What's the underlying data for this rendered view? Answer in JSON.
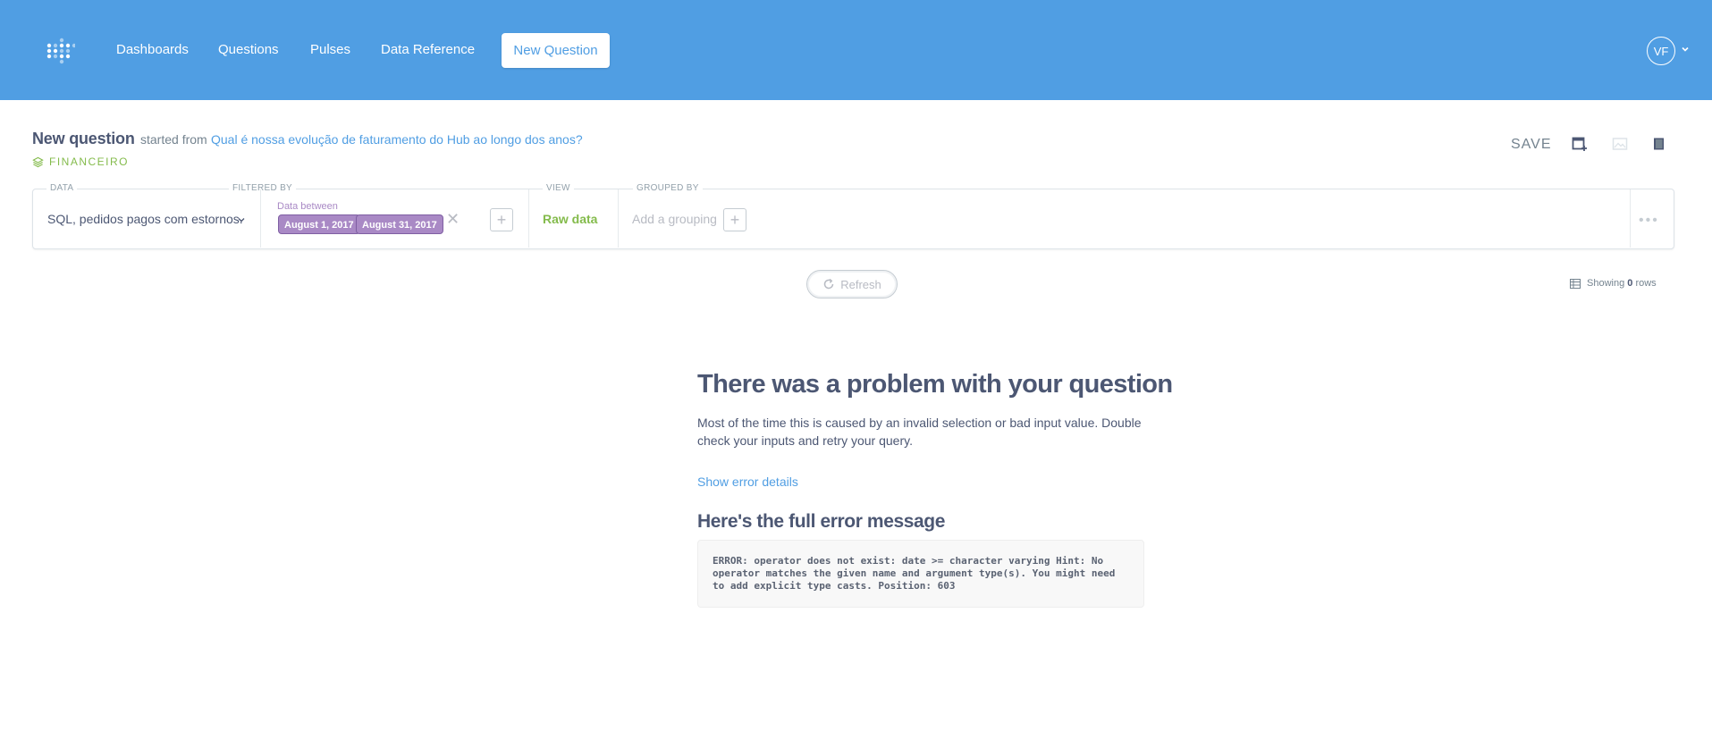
{
  "nav": {
    "logo_icon": "metabase-logo-icon",
    "links": [
      {
        "label": "Dashboards"
      },
      {
        "label": "Questions"
      },
      {
        "label": "Pulses"
      },
      {
        "label": "Data Reference"
      }
    ],
    "new_question": "New Question",
    "avatar_initials": "VF",
    "colors": {
      "bar": "#509ee3",
      "text": "#ffffff"
    }
  },
  "header": {
    "title": "New question",
    "started_from_prefix": "started from",
    "started_from_link": "Qual é nossa evolução de faturamento do Hub ao longo dos anos?",
    "collection": "FINANCEIRO",
    "save_label": "SAVE",
    "icons": [
      "add-to-dashboard-icon",
      "image-icon",
      "book-icon"
    ]
  },
  "query": {
    "data_label": "DATA",
    "data_source": "SQL, pedidos pagos com estornos.",
    "filtered_label": "FILTERED BY",
    "filter_label": "Data between",
    "filter_values": [
      "August 1, 2017",
      "August 31, 2017"
    ],
    "view_label": "VIEW",
    "view_value": "Raw data",
    "grouped_label": "GROUPED BY",
    "grouping_placeholder": "Add a grouping"
  },
  "results": {
    "refresh_label": "Refresh",
    "showing_prefix": "Showing",
    "row_count": "0",
    "showing_suffix": "rows"
  },
  "error": {
    "title": "There was a problem with your question",
    "description": "Most of the time this is caused by an invalid selection or bad input value. Double check your inputs and retry your query.",
    "details_link": "Show error details",
    "full_message_heading": "Here's the full error message",
    "message": "ERROR: operator does not exist: date >= character varying Hint: No operator matches the given name and argument type(s). You might need to add explicit type casts. Position: 603"
  }
}
